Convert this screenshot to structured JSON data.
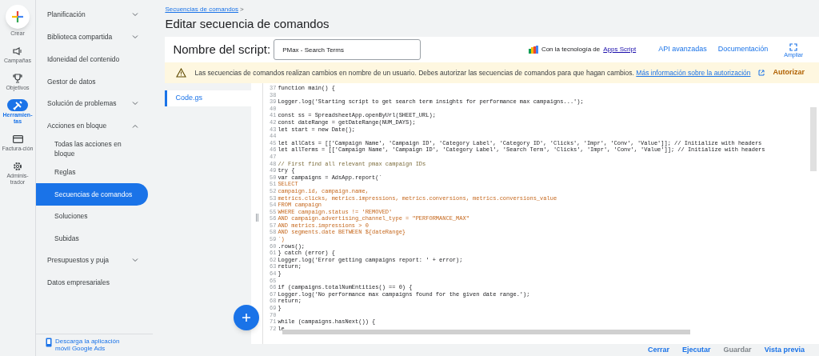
{
  "rail": [
    {
      "label": "Crear",
      "kind": "create",
      "selected": false
    },
    {
      "label": "Campañas",
      "kind": "megaphone",
      "selected": false
    },
    {
      "label": "Objetivos",
      "kind": "trophy",
      "selected": false
    },
    {
      "label": "Herramien-tas",
      "kind": "tools",
      "selected": true
    },
    {
      "label": "Factura-ción",
      "kind": "card",
      "selected": false
    },
    {
      "label": "Adminis-trador",
      "kind": "gear",
      "selected": false
    }
  ],
  "nav": [
    {
      "label": "Planificación",
      "expanded": false,
      "selected": false
    },
    {
      "label": "Biblioteca compartida",
      "expanded": false,
      "selected": false
    },
    {
      "label": "Idoneidad del contenido",
      "selected": false
    },
    {
      "label": "Gestor de datos",
      "selected": false
    },
    {
      "label": "Solución de problemas",
      "expanded": false,
      "selected": false
    },
    {
      "label": "Acciones en bloque",
      "expanded": true,
      "selected": false,
      "children": [
        {
          "label": "Todas las acciones en bloque",
          "selected": false
        },
        {
          "label": "Reglas",
          "selected": false
        },
        {
          "label": "Secuencias de comandos",
          "selected": true
        },
        {
          "label": "Soluciones",
          "selected": false
        },
        {
          "label": "Subidas",
          "selected": false
        }
      ]
    },
    {
      "label": "Presupuestos y puja",
      "expanded": false,
      "selected": false
    },
    {
      "label": "Datos empresariales",
      "selected": false
    }
  ],
  "app_download": "Descarga la aplicación móvil Google Ads",
  "breadcrumb": "Secuencias de comandos",
  "breadcrumb_sep": ">",
  "title": "Editar secuencia de comandos",
  "script_name": {
    "label": "Nombre del script:",
    "value": "PMax - Search Terms"
  },
  "powered_by": {
    "text": "Con la tecnología de",
    "link": "Apps Script"
  },
  "header_links": [
    "API avanzadas",
    "Documentación"
  ],
  "expand_label": "Ampliar",
  "warning": {
    "text": "Las secuencias de comandos realizan cambios en nombre de un usuario. Debes autorizar las secuencias de comandos para que hagan cambios.",
    "link": "Más información sobre la autorización",
    "action": "Autorizar"
  },
  "files": [
    {
      "name": "Code.gs",
      "selected": true
    }
  ],
  "code_lines": [
    {
      "n": "37",
      "text": "function main() {",
      "kind": "code"
    },
    {
      "n": "38"
    },
    {
      "n": "39",
      "text": "Logger.log('Starting script to get search term insights for performance max campaigns...');",
      "kind": "code"
    },
    {
      "n": "40"
    },
    {
      "n": "41",
      "text": "const ss = SpreadsheetApp.openByUrl(SHEET_URL);",
      "kind": "code"
    },
    {
      "n": "42",
      "text": "const dateRange = getDateRange(NUM_DAYS);",
      "kind": "code"
    },
    {
      "n": "43",
      "text": "let start = new Date();",
      "kind": "code"
    },
    {
      "n": "44"
    },
    {
      "n": "45",
      "text": "let allCats = [['Campaign Name', 'Campaign ID', 'Category Label', 'Category ID', 'Clicks', 'Impr', 'Conv', 'Value']]; // Initialize with headers",
      "kind": "code"
    },
    {
      "n": "46",
      "text": "let allTerms = [['Campaign Name', 'Campaign ID', 'Category Label', 'Search Term', 'Clicks', 'Impr', 'Conv', 'Value']]; // Initialize with headers",
      "kind": "code"
    },
    {
      "n": "47"
    },
    {
      "n": "48",
      "text": "// First find all relevant pmax campaign IDs",
      "kind": "comment"
    },
    {
      "n": "49",
      "text": "try {",
      "kind": "code"
    },
    {
      "n": "50",
      "text": "var campaigns = AdsApp.report(`",
      "kind": "code"
    },
    {
      "n": "51",
      "text": "SELECT",
      "kind": "sql"
    },
    {
      "n": "52",
      "text": "campaign.id, campaign.name,",
      "kind": "sql"
    },
    {
      "n": "53",
      "text": "metrics.clicks, metrics.impressions, metrics.conversions, metrics.conversions_value",
      "kind": "sql"
    },
    {
      "n": "54",
      "text": "FROM campaign",
      "kind": "sql"
    },
    {
      "n": "55",
      "text": "WHERE campaign.status != 'REMOVED'",
      "kind": "sql"
    },
    {
      "n": "56",
      "text": "AND campaign.advertising_channel_type = \"PERFORMANCE_MAX\"",
      "kind": "sql"
    },
    {
      "n": "57",
      "text": "AND metrics.impressions > 0",
      "kind": "sql"
    },
    {
      "n": "58",
      "text": "AND segments.date BETWEEN ${dateRange}",
      "kind": "sql"
    },
    {
      "n": "59",
      "text": "`)",
      "kind": "sql"
    },
    {
      "n": "60",
      "text": ".rows();",
      "kind": "code"
    },
    {
      "n": "61",
      "text": "} catch (error) {",
      "kind": "code"
    },
    {
      "n": "62",
      "text": "Logger.log('Error getting campaigns report: ' + error);",
      "kind": "code"
    },
    {
      "n": "63",
      "text": "return;",
      "kind": "code"
    },
    {
      "n": "64",
      "text": "}",
      "kind": "code"
    },
    {
      "n": "65"
    },
    {
      "n": "66",
      "text": "if (campaigns.totalNumEntities() == 0) {",
      "kind": "code"
    },
    {
      "n": "67",
      "text": "Logger.log('No performance max campaigns found for the given date range.');",
      "kind": "code"
    },
    {
      "n": "68",
      "text": "return;",
      "kind": "code"
    },
    {
      "n": "69",
      "text": "}",
      "kind": "code"
    },
    {
      "n": "70"
    },
    {
      "n": "71",
      "text": "while (campaigns.hasNext()) {",
      "kind": "code"
    },
    {
      "n": "72",
      "text": "le",
      "kind": "code"
    }
  ],
  "footer_buttons": [
    {
      "label": "Cerrar",
      "disabled": false
    },
    {
      "label": "Ejecutar",
      "disabled": false
    },
    {
      "label": "Guardar",
      "disabled": true
    },
    {
      "label": "Vista previa",
      "disabled": false
    }
  ]
}
